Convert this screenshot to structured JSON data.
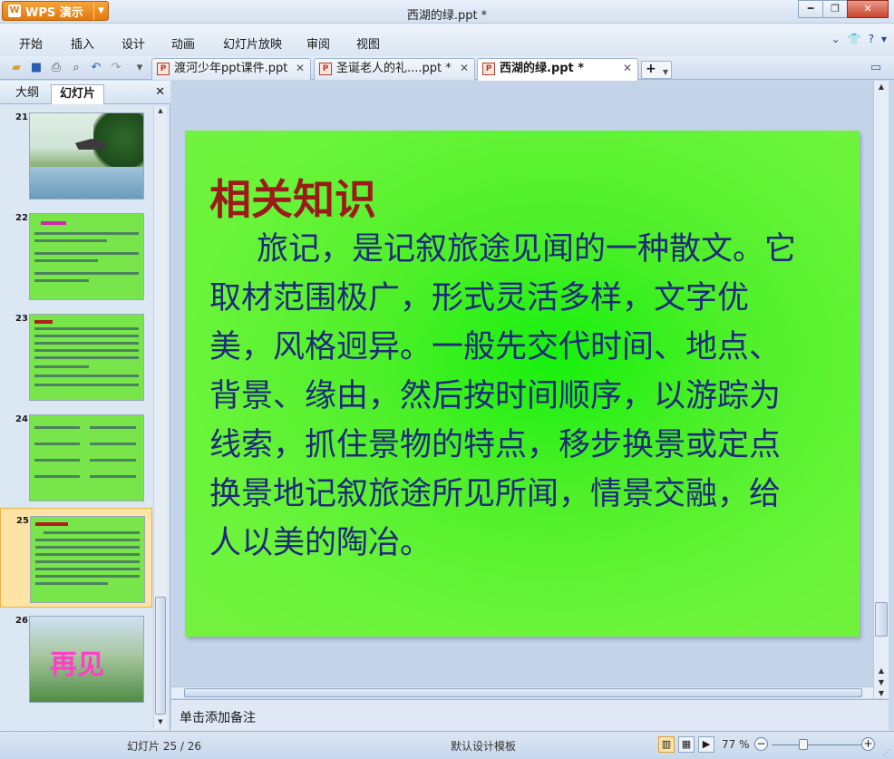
{
  "app": {
    "brand": "WPS 演示",
    "window_title": "西湖的绿.ppt *"
  },
  "menu": [
    "开始",
    "插入",
    "设计",
    "动画",
    "幻灯片放映",
    "审阅",
    "视图"
  ],
  "doc_tabs": [
    {
      "label": "渡河少年ppt课件.ppt",
      "active": false
    },
    {
      "label": "圣诞老人的礼....ppt *",
      "active": false
    },
    {
      "label": "西湖的绿.ppt *",
      "active": true
    }
  ],
  "panel": {
    "tabs": [
      "大纲",
      "幻灯片"
    ],
    "active_tab": "幻灯片"
  },
  "thumbnails": [
    {
      "num": "21"
    },
    {
      "num": "22"
    },
    {
      "num": "23"
    },
    {
      "num": "24"
    },
    {
      "num": "25",
      "selected": true
    },
    {
      "num": "26",
      "overlay_text": "再见"
    }
  ],
  "slide": {
    "title": "相关知识",
    "body": "旅记，是记叙旅途见闻的一种散文。它取材范围极广，形式灵活多样，文字优美，风格迥异。一般先交代时间、地点、背景、缘由，然后按时间顺序，以游踪为线索，抓住景物的特点，移步换景或定点换景地记叙旅途所见所闻，情景交融，给人以美的陶冶。"
  },
  "notes_placeholder": "单击添加备注",
  "status": {
    "slide_counter": "幻灯片 25 / 26",
    "template": "默认设计模板",
    "zoom": "77 %"
  },
  "colors": {
    "slide_bg": "#6af43a",
    "title": "#9b1b1b",
    "body": "#1f2a7a",
    "selected_thumb": "#fde3a5"
  }
}
